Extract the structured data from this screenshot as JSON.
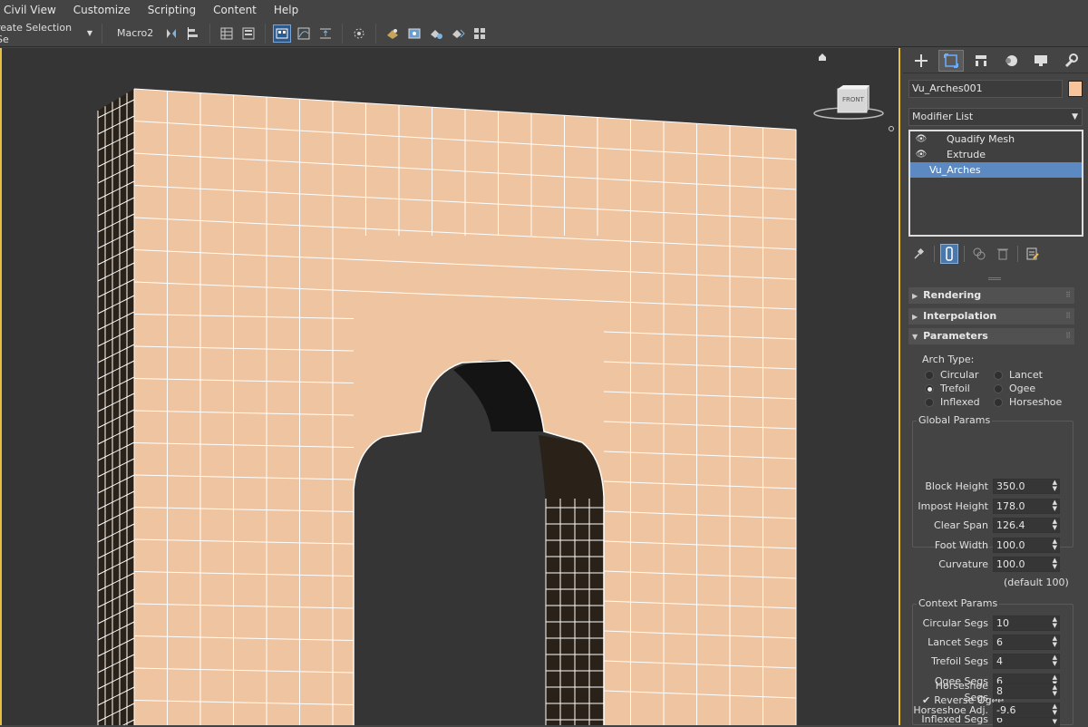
{
  "menu": [
    "Civil View",
    "Customize",
    "Scripting",
    "Content",
    "Help"
  ],
  "toolbar": {
    "selection_set": "reate Selection Se",
    "macro_label": "Macro2"
  },
  "viewport": {
    "viewcube_label": "FRONT",
    "mesh_color": "#efc4a0",
    "background": "#353535"
  },
  "command_panel": {
    "tabs": [
      "create-icon",
      "modify-icon",
      "hierarchy-icon",
      "motion-icon",
      "display-icon",
      "utilities-icon"
    ],
    "object_name": "Vu_Arches001",
    "object_color": "#f7c49c",
    "modifier_list_label": "Modifier List",
    "stack": [
      {
        "label": "Quadify Mesh",
        "eye": true,
        "selected": false
      },
      {
        "label": "Extrude",
        "eye": true,
        "selected": false
      },
      {
        "label": "Vu_Arches",
        "eye": false,
        "selected": true
      }
    ],
    "rollouts": {
      "rendering": "Rendering",
      "interpolation": "Interpolation",
      "parameters": "Parameters"
    },
    "arch_type": {
      "label": "Arch Type:",
      "options": [
        "Circular",
        "Lancet",
        "Trefoil",
        "Ogee",
        "Inflexed",
        "Horseshoe"
      ],
      "selected": "Trefoil"
    },
    "global_params": {
      "title": "Global Params",
      "block_height_label": "Block Height",
      "block_height": "350.0",
      "impost_height_label": "Impost Height",
      "impost_height": "178.0",
      "clear_span_label": "Clear Span",
      "clear_span": "126.4",
      "foot_width_label": "Foot Width",
      "foot_width": "100.0",
      "curvature_label": "Curvature",
      "curvature": "100.0",
      "default_note": "(default 100)"
    },
    "context_params": {
      "title": "Context Params",
      "circular_segs_label": "Circular Segs",
      "circular_segs": "10",
      "lancet_segs_label": "Lancet Segs",
      "lancet_segs": "6",
      "trefoil_segs_label": "Trefoil Segs",
      "trefoil_segs": "4",
      "ogee_segs_label": "Ogee Segs",
      "ogee_segs": "6",
      "reverse_ogee_label": "Reverse Ogee",
      "inflexed_segs_label": "Inflexed Segs",
      "inflexed_segs": "6",
      "horseshoe_segs_label": "Horseshoe Segs",
      "horseshoe_segs": "8",
      "horseshoe_adj_label": "Horseshoe Adj.",
      "horseshoe_adj": "-9.6"
    }
  }
}
